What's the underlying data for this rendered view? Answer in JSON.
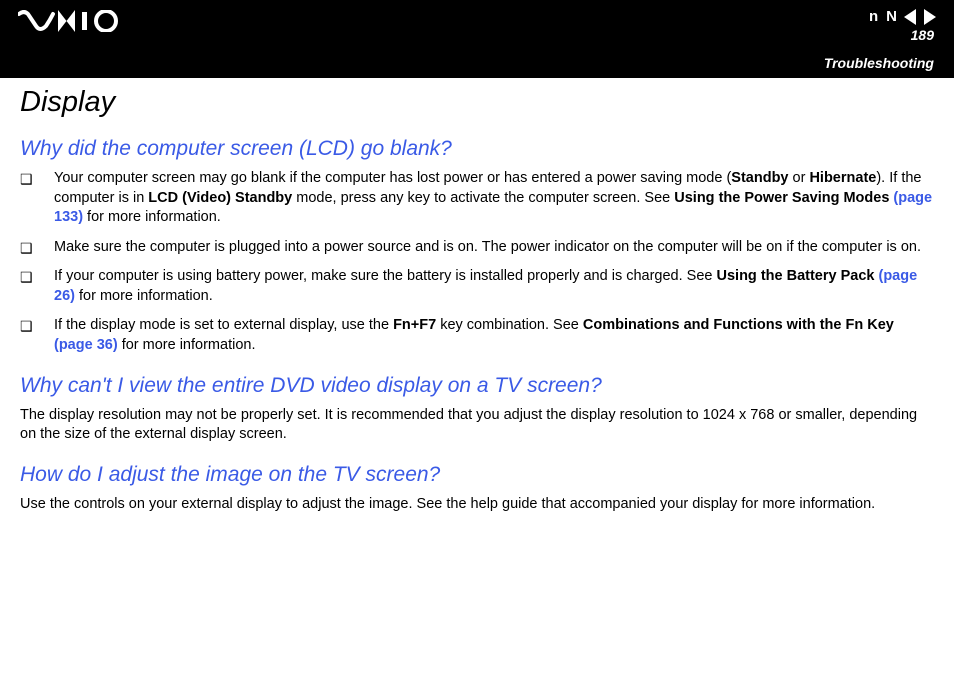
{
  "header": {
    "page_number": "189",
    "breadcrumb": "Troubleshooting",
    "nav": {
      "n_letter": "n",
      "N_letter": "N"
    }
  },
  "content": {
    "title": "Display",
    "q1": {
      "heading": "Why did the computer screen (LCD) go blank?",
      "b1_a": "Your computer screen may go blank if the computer has lost power or has entered a power saving mode (",
      "b1_bold1": "Standby",
      "b1_b": " or ",
      "b1_bold2": "Hibernate",
      "b1_c": "). If the computer is in ",
      "b1_bold3": "LCD (Video) Standby",
      "b1_d": " mode, press any key to activate the computer screen. See ",
      "b1_bold4": "Using the Power Saving Modes",
      "b1_link": " (page 133)",
      "b1_e": " for more information.",
      "b2": "Make sure the computer is plugged into a power source and is on. The power indicator on the computer will be on if the computer is on.",
      "b3_a": "If your computer is using battery power, make sure the battery is installed properly and is charged. See ",
      "b3_bold": "Using the Battery Pack",
      "b3_link": " (page 26)",
      "b3_b": " for more information.",
      "b4_a": "If the display mode is set to external display, use the ",
      "b4_bold1": "Fn+F7",
      "b4_b": " key combination. See ",
      "b4_bold2": "Combinations and Functions with the Fn Key",
      "b4_link": " (page 36)",
      "b4_c": " for more information."
    },
    "q2": {
      "heading": "Why can't I view the entire DVD video display on a TV screen?",
      "body": "The display resolution may not be properly set. It is recommended that you adjust the display resolution to 1024 x 768 or smaller, depending on the size of the external display screen."
    },
    "q3": {
      "heading": "How do I adjust the image on the TV screen?",
      "body": "Use the controls on your external display to adjust the image. See the help guide that accompanied your display for more information."
    }
  }
}
